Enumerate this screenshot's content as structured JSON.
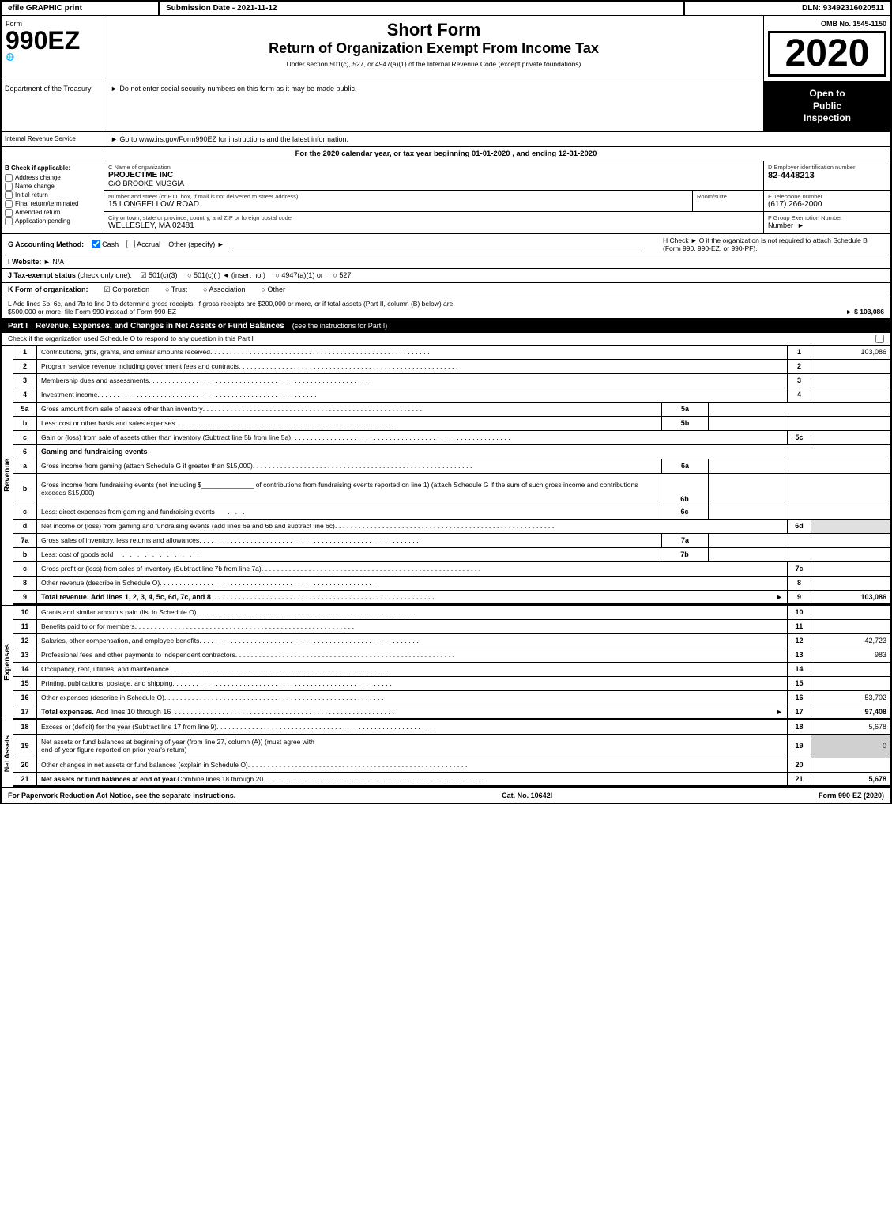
{
  "header": {
    "efile": "efile GRAPHIC print",
    "submission_label": "Submission Date - 2021-11-12",
    "dln": "DLN: 93492316020511"
  },
  "form": {
    "number": "990EZ",
    "symbol": "🌐",
    "short_form": "Short Form",
    "return_title": "Return of Organization Exempt From Income Tax",
    "under_text": "Under section 501(c), 527, or 4947(a)(1) of the Internal Revenue Code (except private foundations)",
    "do_not_enter": "► Do not enter social security numbers on this form as it may be made public.",
    "go_to": "► Go to www.irs.gov/Form990EZ for instructions and the latest information.",
    "omb": "OMB No. 1545-1150",
    "year": "2020",
    "open_public": "Open to\nPublic\nInspection",
    "dept": "Department of the Treasury",
    "irs_label": "Internal Revenue Service",
    "tax_year_text": "For the 2020 calendar year, or tax year beginning 01-01-2020 , and ending 12-31-2020"
  },
  "checkboxes": {
    "check_label": "B Check if applicable:",
    "items": [
      {
        "label": "Address change",
        "checked": false
      },
      {
        "label": "Name change",
        "checked": false
      },
      {
        "label": "Initial return",
        "checked": false
      },
      {
        "label": "Final return/terminated",
        "checked": false
      },
      {
        "label": "Amended return",
        "checked": false
      },
      {
        "label": "Application pending",
        "checked": false
      }
    ]
  },
  "org": {
    "c_label": "C Name of organization",
    "name": "PROJECTME INC",
    "care_of": "C/O BROOKE MUGGIA",
    "address_label": "Number and street (or P.O. box, if mail is not delivered to street address)",
    "address": "15 LONGFELLOW ROAD",
    "room_suite_label": "Room/suite",
    "room_suite": "",
    "city_label": "City or town, state or province, country, and ZIP or foreign postal code",
    "city": "WELLESLEY, MA  02481",
    "d_label": "D Employer identification number",
    "ein": "82-4448213",
    "e_label": "E Telephone number",
    "phone": "(617) 266-2000",
    "f_label": "F Group Exemption Number",
    "group_num": ""
  },
  "accounting": {
    "g_label": "G Accounting Method:",
    "cash_checked": true,
    "accrual_checked": false,
    "other_label": "Other (specify) ►",
    "other_value": "",
    "h_text": "H  Check ►  O if the organization is not required to attach Schedule B (Form 990, 990-EZ, or 990-PF)."
  },
  "website": {
    "label": "I Website: ►",
    "value": "N/A"
  },
  "tax_status": {
    "j_label": "J Tax-exempt status",
    "check_label": "(check only one):",
    "options": [
      "☑ 501(c)(3)",
      "○ 501(c)(  ) ◄ (insert no.)",
      "○ 4947(a)(1) or",
      "○ 527"
    ]
  },
  "form_org": {
    "k_label": "K Form of organization:",
    "options": [
      "☑ Corporation",
      "○ Trust",
      "○ Association",
      "○ Other"
    ]
  },
  "gross_receipts": {
    "l_text": "L Add lines 5b, 6c, and 7b to line 9 to determine gross receipts. If gross receipts are $200,000 or more, or if total assets (Part II, column (B) below) are $500,000 or more, file Form 990 instead of Form 990-EZ",
    "amount": "► $ 103,086"
  },
  "part1": {
    "title": "Part I",
    "subtitle": "Revenue, Expenses, and Changes in Net Assets or Fund Balances",
    "see_instructions": "(see the instructions for Part I)",
    "schedule_o_text": "Check if the organization used Schedule O to respond to any question in this Part I",
    "lines": [
      {
        "num": "1",
        "desc": "Contributions, gifts, grants, and similar amounts received",
        "ref": "1",
        "amount": "103,086"
      },
      {
        "num": "2",
        "desc": "Program service revenue including government fees and contracts",
        "ref": "2",
        "amount": ""
      },
      {
        "num": "3",
        "desc": "Membership dues and assessments",
        "ref": "3",
        "amount": ""
      },
      {
        "num": "4",
        "desc": "Investment income",
        "ref": "4",
        "amount": ""
      },
      {
        "num": "5a",
        "desc": "Gross amount from sale of assets other than inventory",
        "sub_ref": "5a",
        "amount": ""
      },
      {
        "num": "b",
        "desc": "Less: cost or other basis and sales expenses",
        "sub_ref": "5b",
        "amount": ""
      },
      {
        "num": "c",
        "desc": "Gain or (loss) from sale of assets other than inventory (Subtract line 5b from line 5a)",
        "ref": "5c",
        "amount": ""
      },
      {
        "num": "6",
        "desc": "Gaming and fundraising events",
        "ref": "",
        "amount": ""
      },
      {
        "num": "a",
        "desc": "Gross income from gaming (attach Schedule G if greater than $15,000)",
        "sub_ref": "6a",
        "amount": ""
      },
      {
        "num": "b",
        "desc": "Gross income from fundraising events (not including $_____ of contributions from fundraising events reported on line 1) (attach Schedule G if the sum of such gross income and contributions exceeds $15,000)",
        "sub_ref": "6b",
        "amount": ""
      },
      {
        "num": "c",
        "desc": "Less: direct expenses from gaming and fundraising events",
        "sub_ref": "6c",
        "amount": ""
      },
      {
        "num": "d",
        "desc": "Net income or (loss) from gaming and fundraising events (add lines 6a and 6b and subtract line 6c)",
        "ref": "6d",
        "amount": ""
      },
      {
        "num": "7a",
        "desc": "Gross sales of inventory, less returns and allowances",
        "sub_ref": "7a",
        "amount": ""
      },
      {
        "num": "b",
        "desc": "Less: cost of goods sold",
        "sub_ref": "7b",
        "amount": ""
      },
      {
        "num": "c",
        "desc": "Gross profit or (loss) from sales of inventory (Subtract line 7b from line 7a)",
        "ref": "7c",
        "amount": ""
      },
      {
        "num": "8",
        "desc": "Other revenue (describe in Schedule O)",
        "ref": "8",
        "amount": ""
      },
      {
        "num": "9",
        "desc": "Total revenue. Add lines 1, 2, 3, 4, 5c, 6d, 7c, and 8",
        "ref": "9",
        "amount": "103,086",
        "bold": true,
        "arrow": true
      }
    ]
  },
  "expenses": {
    "lines": [
      {
        "num": "10",
        "desc": "Grants and similar amounts paid (list in Schedule O)",
        "ref": "10",
        "amount": ""
      },
      {
        "num": "11",
        "desc": "Benefits paid to or for members",
        "ref": "11",
        "amount": ""
      },
      {
        "num": "12",
        "desc": "Salaries, other compensation, and employee benefits",
        "ref": "12",
        "amount": "42,723"
      },
      {
        "num": "13",
        "desc": "Professional fees and other payments to independent contractors",
        "ref": "13",
        "amount": "983"
      },
      {
        "num": "14",
        "desc": "Occupancy, rent, utilities, and maintenance",
        "ref": "14",
        "amount": ""
      },
      {
        "num": "15",
        "desc": "Printing, publications, postage, and shipping",
        "ref": "15",
        "amount": ""
      },
      {
        "num": "16",
        "desc": "Other expenses (describe in Schedule O)",
        "ref": "16",
        "amount": "53,702"
      },
      {
        "num": "17",
        "desc": "Total expenses. Add lines 10 through 16",
        "ref": "17",
        "amount": "97,408",
        "bold": true,
        "arrow": true
      }
    ],
    "label": "Expenses"
  },
  "net_assets": {
    "lines": [
      {
        "num": "18",
        "desc": "Excess or (deficit) for the year (Subtract line 17 from line 9)",
        "ref": "18",
        "amount": "5,678"
      },
      {
        "num": "19",
        "desc": "Net assets or fund balances at beginning of year (from line 27, column (A)) (must agree with end-of-year figure reported on prior year's return)",
        "ref": "19",
        "amount": "0"
      },
      {
        "num": "20",
        "desc": "Other changes in net assets or fund balances (explain in Schedule O)",
        "ref": "20",
        "amount": ""
      },
      {
        "num": "21",
        "desc": "Net assets or fund balances at end of year. Combine lines 18 through 20",
        "ref": "21",
        "amount": "5,678",
        "bold": true
      }
    ],
    "label": "Net Assets"
  },
  "footer": {
    "paperwork_text": "For Paperwork Reduction Act Notice, see the separate instructions.",
    "cat_no": "Cat. No. 10642I",
    "form_ref": "Form 990-EZ (2020)"
  }
}
